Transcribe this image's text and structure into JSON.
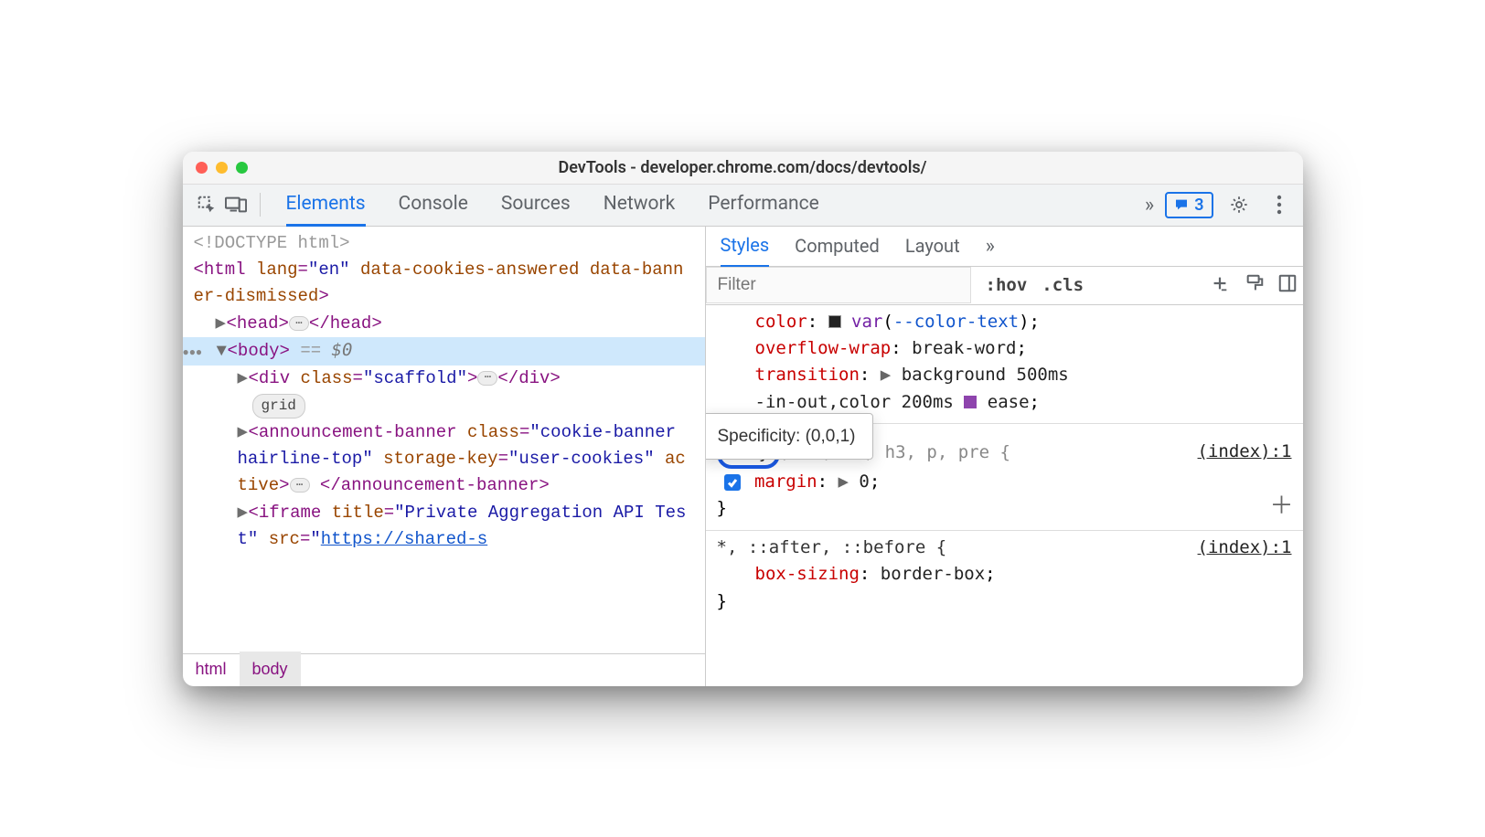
{
  "title": "DevTools - developer.chrome.com/docs/devtools/",
  "toolbar": {
    "tabs": [
      "Elements",
      "Console",
      "Sources",
      "Network",
      "Performance"
    ],
    "active": 0,
    "more": "»",
    "issues": "3"
  },
  "dom": {
    "doctype": "<!DOCTYPE html>",
    "html_open1": "html",
    "html_attrs_lang_name": "lang",
    "html_attrs_lang_val": "\"en\"",
    "html_attr2": "data-cookies-answered",
    "html_attr3": "data-banner-dismissed",
    "head_open": "head",
    "head_close": "/head",
    "body_open": "body",
    "body_eq": " == ",
    "body_dollar": "$0",
    "div_open": "div",
    "div_class_name": "class",
    "div_class_val": "\"scaffold\"",
    "div_close": "/div",
    "grid_pill": "grid",
    "ann_open": "announcement-banner",
    "ann_class_name": "class",
    "ann_class_val": "\"cookie-banner hairline-top\"",
    "ann_storage_name": "storage-key",
    "ann_storage_val": "\"user-cookies\"",
    "ann_active": "active",
    "ann_close": "/announcement-banner",
    "iframe_open": "iframe",
    "iframe_title_name": "title",
    "iframe_title_val": "\"Private Aggregation API Test\"",
    "iframe_src_name": "src",
    "iframe_src_val": "https://shared-s"
  },
  "crumbs": [
    "html",
    "body"
  ],
  "styles": {
    "tabs": [
      "Styles",
      "Computed",
      "Layout"
    ],
    "active": 0,
    "more": "»",
    "filter_placeholder": "Filter",
    "hov": ":hov",
    "cls": ".cls",
    "tooltip": "Specificity: (0,0,1)",
    "rule1": {
      "p1_name": "color",
      "p1_val": "--color-text",
      "p2_name": "overflow-wrap",
      "p2_val": "break-word",
      "p3_name": "transition",
      "p3_val_a": "background 500ms",
      "p3_val_b": "-in-out,color 200ms",
      "p3_val_c": "ease"
    },
    "rule2": {
      "selector_body": "body",
      "selector_rest": ", h1, h2, h3, p, pre {",
      "source": "(index):1",
      "p1_name": "margin",
      "p1_val": "0",
      "close": "}"
    },
    "rule3": {
      "selector": "*, ::after, ::before {",
      "source": "(index):1",
      "p1_name": "box-sizing",
      "p1_val": "border-box",
      "close": "}"
    }
  }
}
